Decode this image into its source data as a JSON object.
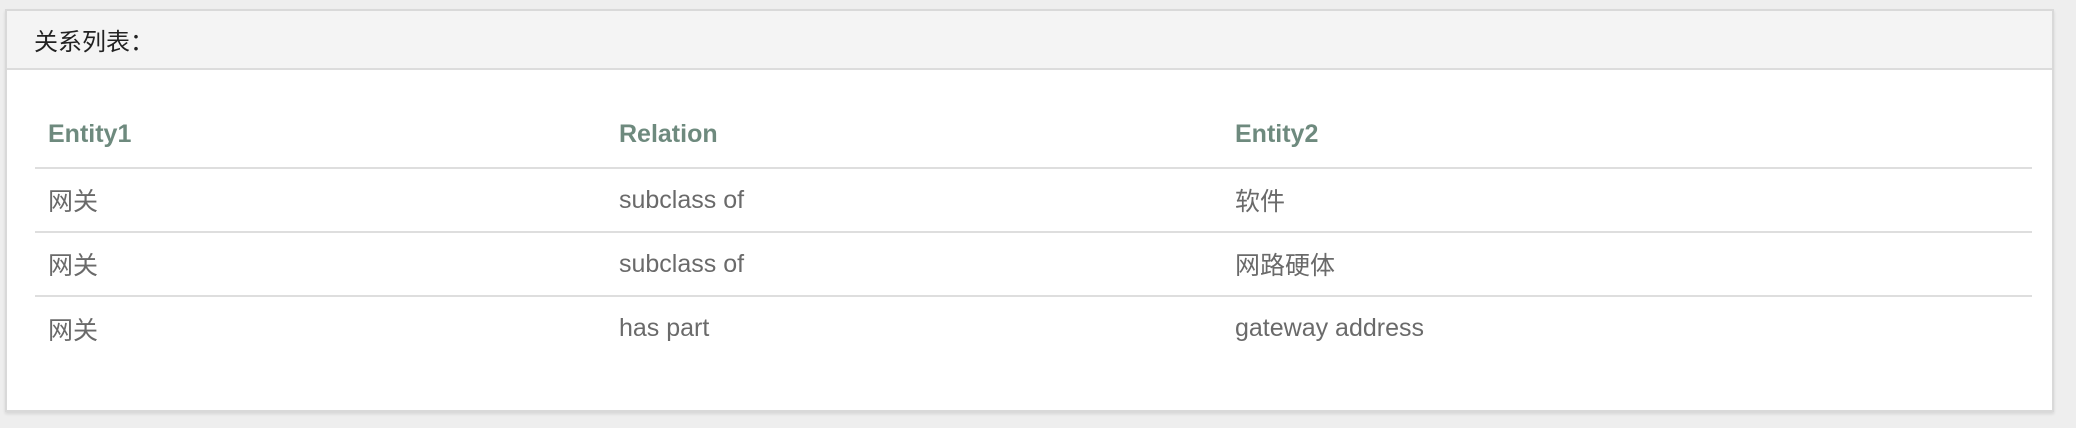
{
  "panel": {
    "title": "关系列表："
  },
  "table": {
    "headers": [
      "Entity1",
      "Relation",
      "Entity2"
    ],
    "rows": [
      [
        "网关",
        "subclass of",
        "软件"
      ],
      [
        "网关",
        "subclass of",
        "网路硬体"
      ],
      [
        "网关",
        "has part",
        "gateway address"
      ]
    ]
  },
  "colors": {
    "header_text": "#6e8a7e",
    "cell_text": "#6a6a6a",
    "panel_heading_bg": "#f4f4f4"
  }
}
